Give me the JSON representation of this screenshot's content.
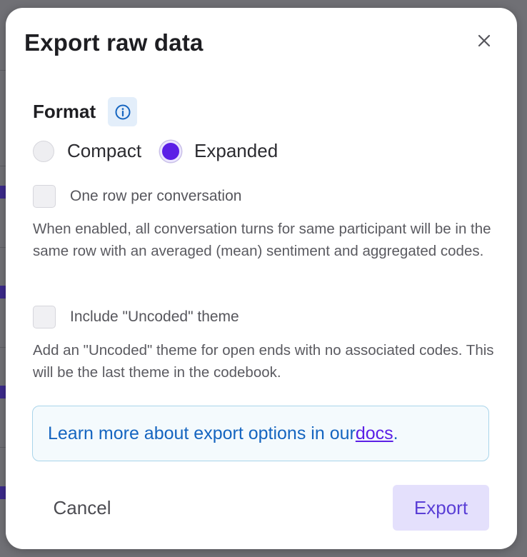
{
  "dialog": {
    "title": "Export raw data",
    "close_icon": "close-icon"
  },
  "format": {
    "label": "Format",
    "info_icon": "info-icon",
    "options": [
      {
        "label": "Compact",
        "selected": false
      },
      {
        "label": "Expanded",
        "selected": true
      }
    ]
  },
  "options": {
    "one_row": {
      "label": "One row per conversation",
      "checked": false,
      "description": "When enabled, all conversation turns for same participant will be in the same row with an averaged (mean) sentiment and aggregated codes."
    },
    "uncoded": {
      "label": "Include \"Uncoded\" theme",
      "checked": false,
      "description": "Add an \"Uncoded\" theme for open ends with no associated codes. This will be the last theme in the codebook."
    }
  },
  "learn_more": {
    "text": "Learn more about export options in our ",
    "link_text": "docs",
    "suffix": "."
  },
  "actions": {
    "cancel_label": "Cancel",
    "export_label": "Export"
  },
  "colors": {
    "accent": "#5b1fe6",
    "link_blue": "#1565c0",
    "export_bg": "#e4e0fc",
    "info_bg": "#f4fafd",
    "info_border": "#a9d4ea",
    "backdrop": "#707075"
  }
}
